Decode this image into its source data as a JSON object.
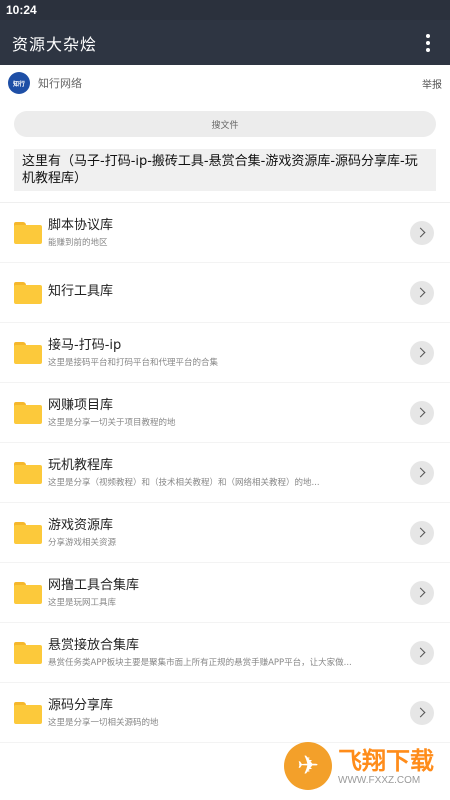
{
  "statusbar": {
    "time": "10:24"
  },
  "appbar": {
    "title": "资源大杂烩",
    "menu_icon": "more-vert-icon"
  },
  "source": {
    "logo_text": "知行",
    "name": "知行网络",
    "report_label": "举报"
  },
  "search": {
    "placeholder": "搜文件"
  },
  "notice": {
    "text": "这里有（马子-打码-ip-搬砖工具-悬赏合集-游戏资源库-源码分享库-玩机教程库）"
  },
  "items": [
    {
      "title": "脚本协议库",
      "desc": "能赚到前的地区"
    },
    {
      "title": "知行工具库",
      "desc": ""
    },
    {
      "title": "接马-打码-ip",
      "desc": "这里是接码平台和打码平台和代理平台的合集"
    },
    {
      "title": "网赚项目库",
      "desc": "这里是分享一切关于项目教程的地"
    },
    {
      "title": "玩机教程库",
      "desc": "这里是分享（视频教程）和（技术相关教程）和（网络相关教程）的地..."
    },
    {
      "title": "游戏资源库",
      "desc": "分享游戏相关资源"
    },
    {
      "title": "网撸工具合集库",
      "desc": "这里是玩网工具库"
    },
    {
      "title": "悬赏接放合集库",
      "desc": "悬赏任务类APP板块主要是聚集市面上所有正规的悬赏手赚APP平台，让大家做..."
    },
    {
      "title": "源码分享库",
      "desc": "这里是分享一切相关源码的地"
    }
  ],
  "watermark": {
    "main": "飞翔下载",
    "url": "WWW.FXXZ.COM"
  },
  "colors": {
    "appbar": "#2e3542",
    "statusbar": "#2b313d",
    "folder": "#fcc93b",
    "logo": "#1e4fa6"
  }
}
